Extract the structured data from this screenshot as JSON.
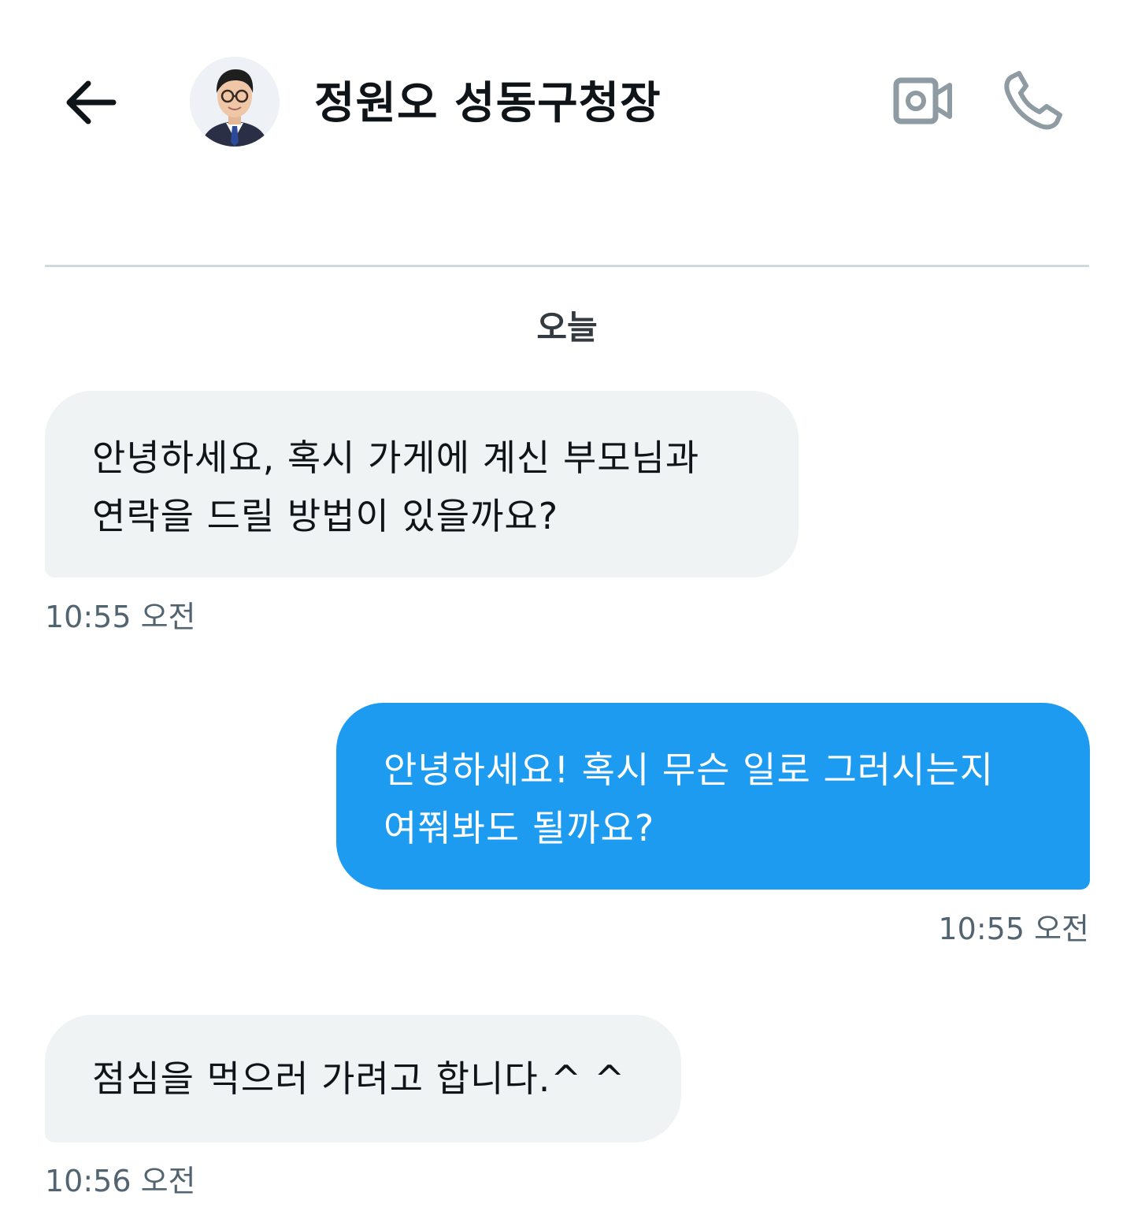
{
  "header": {
    "back_icon": "arrow-left-icon",
    "avatar_icon": "profile-photo",
    "title": "정원오 성동구청장",
    "video_icon": "video-camera-icon",
    "phone_icon": "phone-icon"
  },
  "conversation": {
    "date_separator": "오늘",
    "messages": [
      {
        "direction": "incoming",
        "lines": [
          "안녕하세요, 혹시 가게에 계신 부모님과",
          "연락을 드릴 방법이 있을까요?"
        ],
        "time": "10:55 오전"
      },
      {
        "direction": "outgoing",
        "lines": [
          "안녕하세요! 혹시 무슨 일로 그러시는지",
          "여쭤봐도 될까요?"
        ],
        "time": "10:55 오전"
      },
      {
        "direction": "incoming",
        "lines": [
          "점심을 먹으러 가려고 합니다.^ ^"
        ],
        "time": "10:56 오전"
      }
    ]
  },
  "colors": {
    "outgoing_bubble": "#1d9bf0",
    "incoming_bubble": "#eff3f4",
    "timestamp": "#536471",
    "divider": "#cfd9de"
  }
}
